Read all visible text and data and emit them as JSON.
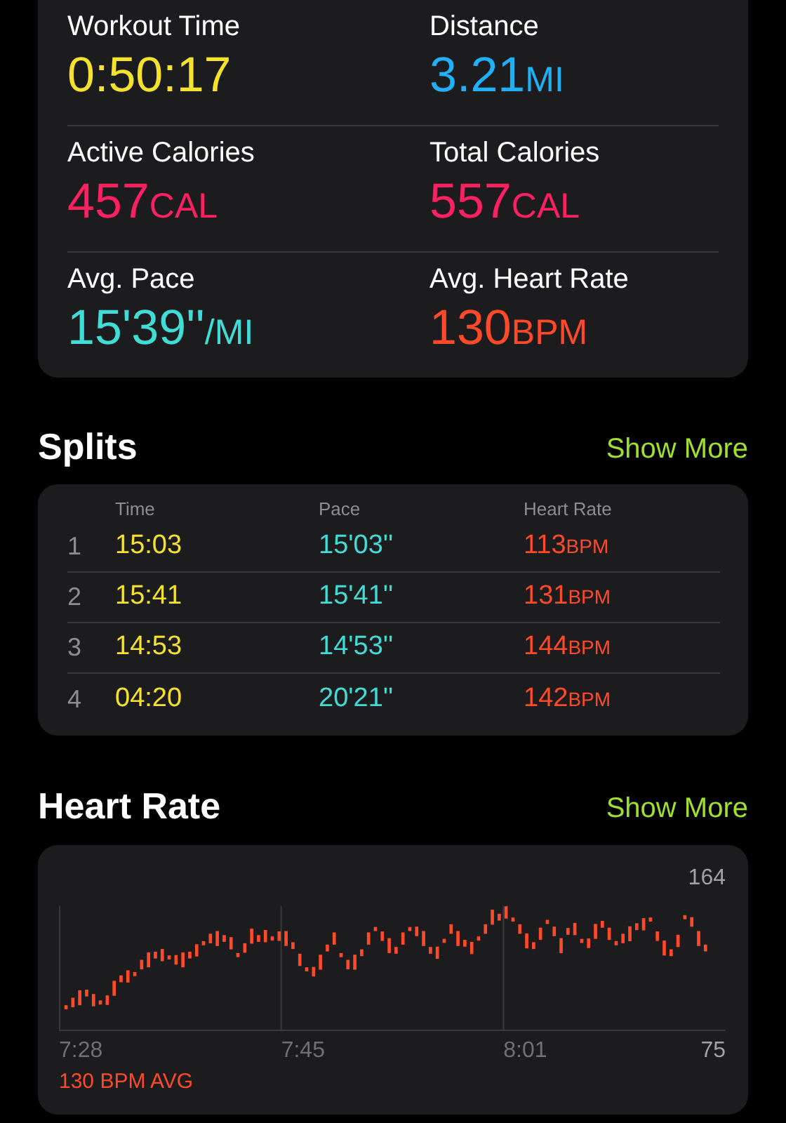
{
  "summary": {
    "metrics": [
      {
        "kind": "time",
        "label": "Workout Time",
        "value": "0:50:17"
      },
      {
        "kind": "distance",
        "label": "Distance",
        "value": "3.21",
        "unit": "MI"
      },
      {
        "kind": "calories",
        "label": "Active Calories",
        "value": "457",
        "unit": "CAL"
      },
      {
        "kind": "calories",
        "label": "Total Calories",
        "value": "557",
        "unit": "CAL"
      },
      {
        "kind": "pace",
        "label": "Avg. Pace",
        "value": "15'39''",
        "unit": "/MI"
      },
      {
        "kind": "heart",
        "label": "Avg. Heart Rate",
        "value": "130",
        "unit": "BPM"
      }
    ]
  },
  "splits": {
    "title": "Splits",
    "action": "Show More",
    "columns": [
      "Time",
      "Pace",
      "Heart Rate"
    ],
    "rows": [
      {
        "number": "1",
        "time": "15:03",
        "pace": "15'03''",
        "heart_rate": "113",
        "unit": "BPM"
      },
      {
        "number": "2",
        "time": "15:41",
        "pace": "15'41''",
        "heart_rate": "131",
        "unit": "BPM"
      },
      {
        "number": "3",
        "time": "14:53",
        "pace": "14'53''",
        "heart_rate": "144",
        "unit": "BPM"
      },
      {
        "number": "4",
        "time": "04:20",
        "pace": "20'21''",
        "heart_rate": "142",
        "unit": "BPM"
      }
    ]
  },
  "heart_rate": {
    "title": "Heart Rate",
    "action": "Show More",
    "max_label": "164",
    "min_label": "75",
    "times": [
      "7:28",
      "7:45",
      "8:01"
    ],
    "average": "130 BPM AVG"
  }
}
